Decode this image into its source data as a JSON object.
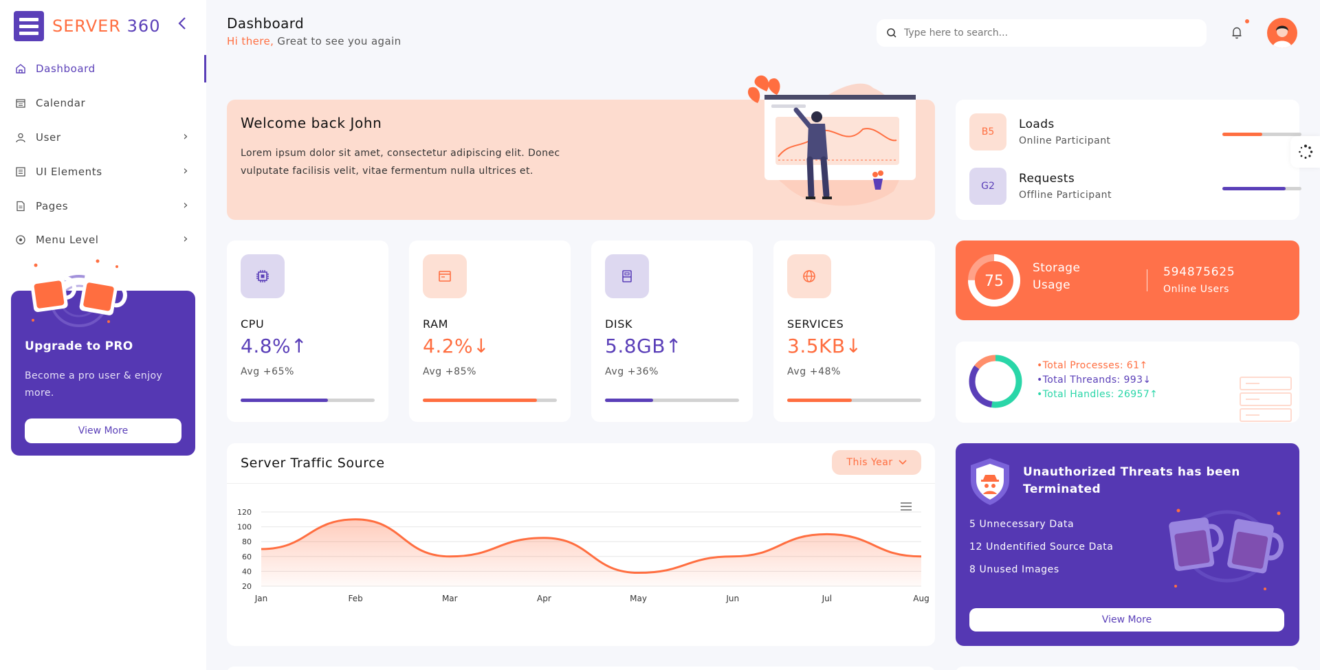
{
  "brand": {
    "logo_a": "SERVER",
    "logo_b": " 360"
  },
  "sidebar": {
    "items": [
      {
        "label": "Dashboard"
      },
      {
        "label": "Calendar"
      },
      {
        "label": "User"
      },
      {
        "label": "UI Elements"
      },
      {
        "label": "Pages"
      },
      {
        "label": "Menu Level"
      }
    ],
    "pro": {
      "title": "Upgrade to PRO",
      "text": "Become a pro user & enjoy more.",
      "button": "View More"
    }
  },
  "header": {
    "title": "Dashboard",
    "greeting_hi": "Hi there,",
    "greeting_rest": " Great to see you again",
    "search_placeholder": "Type here to search..."
  },
  "welcome": {
    "title": "Welcome back John",
    "text": "Lorem ipsum dolor sit amet, consectetur adipiscing elit. Donec vulputate facilisis velit, vitae fermentum nulla ultrices et."
  },
  "stats": [
    {
      "label": "CPU",
      "value": "4.8%",
      "trend": "↑",
      "avg": "Avg +65%",
      "progress": 0.65,
      "color": "#5a3fb8",
      "bg": "#ddd8f0"
    },
    {
      "label": "RAM",
      "value": "4.2%",
      "trend": "↓",
      "avg": "Avg +85%",
      "progress": 0.85,
      "color": "#ff6e40",
      "bg": "#fde0d4"
    },
    {
      "label": "DISK",
      "value": "5.8GB",
      "trend": "↑",
      "avg": "Avg +36%",
      "progress": 0.36,
      "color": "#5a3fb8",
      "bg": "#ddd8f0"
    },
    {
      "label": "SERVICES",
      "value": "3.5KB",
      "trend": "↓",
      "avg": "Avg +48%",
      "progress": 0.48,
      "color": "#ff6e40",
      "bg": "#fde0d4"
    }
  ],
  "loads": [
    {
      "badge": "B5",
      "title": "Loads",
      "sub": "Online Participant",
      "progress": 0.5,
      "color": "#ff6e40",
      "bg": "#fde0d4"
    },
    {
      "badge": "G2",
      "title": "Requests",
      "sub": "Offline Participant",
      "progress": 0.8,
      "color": "#5a3fb8",
      "bg": "#ddd8f0"
    }
  ],
  "storage": {
    "value": "75",
    "label_1": "Storage",
    "label_2": "Usage",
    "users": "594875625",
    "users_label": "Online Users"
  },
  "processes": [
    {
      "text": "•Total Processes: 61↑",
      "color": "#ff6e40"
    },
    {
      "text": "•Total Threands: 993↓",
      "color": "#5a3fb8"
    },
    {
      "text": "•Total Handles: 26957↑",
      "color": "#2ad6a8"
    }
  ],
  "traffic": {
    "title": "Server Traffic Source",
    "filter": "This Year",
    "chart_data": {
      "type": "area",
      "categories": [
        "Jan",
        "Feb",
        "Mar",
        "Apr",
        "May",
        "Jun",
        "Jul",
        "Aug"
      ],
      "series": [
        {
          "values": [
            70,
            110,
            60,
            85,
            38,
            60,
            90,
            60
          ]
        }
      ],
      "yticks": [
        20,
        40,
        60,
        80,
        100,
        120
      ],
      "ylim": [
        20,
        120
      ],
      "grid": true,
      "color": "#ff6e40"
    }
  },
  "threats": {
    "title": "Unauthorized Threats has been Terminated",
    "items": [
      "5 Unnecessary Data",
      "12 Undentified Source Data",
      "8 Unused Images"
    ],
    "button": "View More"
  }
}
